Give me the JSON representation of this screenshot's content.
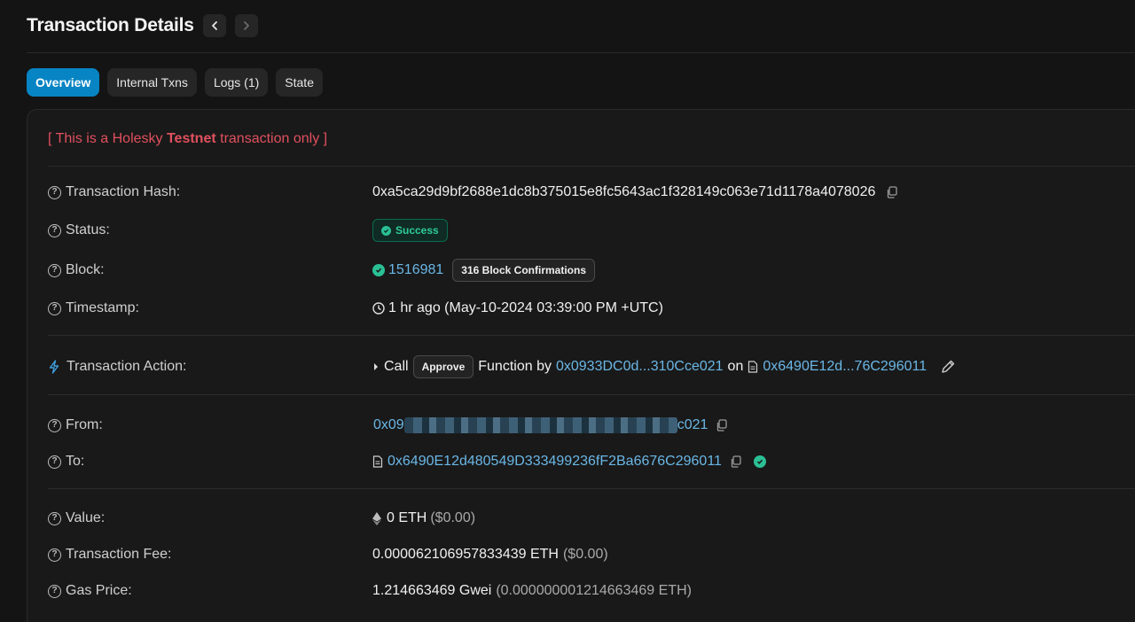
{
  "header": {
    "title": "Transaction Details",
    "prev_icon": "chevron-left-icon",
    "next_icon": "chevron-right-icon"
  },
  "tabs": [
    {
      "label": "Overview",
      "active": true
    },
    {
      "label": "Internal Txns",
      "active": false
    },
    {
      "label": "Logs (1)",
      "active": false
    },
    {
      "label": "State",
      "active": false
    }
  ],
  "notice": {
    "prefix": "[ This is a Holesky ",
    "bold": "Testnet",
    "suffix": " transaction only ]"
  },
  "rows": {
    "hash": {
      "label": "Transaction Hash:",
      "value": "0xa5ca29d9bf2688e1dc8b375015e8fc5643ac1f328149c063e71d1178a4078026"
    },
    "status": {
      "label": "Status:",
      "value": "Success"
    },
    "block": {
      "label": "Block:",
      "number": "1516981",
      "confirmations": "316 Block Confirmations"
    },
    "timestamp": {
      "label": "Timestamp:",
      "value": "1 hr ago (May-10-2024 03:39:00 PM +UTC)"
    },
    "action": {
      "label": "Transaction Action:",
      "call": "Call",
      "method": "Approve",
      "function_by": "Function by",
      "caller": "0x0933DC0d...310Cce021",
      "on": "on",
      "contract": "0x6490E12d...76C296011"
    },
    "from": {
      "label": "From:",
      "prefix": "0x09",
      "suffix": "c021"
    },
    "to": {
      "label": "To:",
      "value": "0x6490E12d480549D333499236fF2Ba6676C296011"
    },
    "value": {
      "label": "Value:",
      "amount": "0 ETH",
      "usd": "($0.00)"
    },
    "fee": {
      "label": "Transaction Fee:",
      "amount": "0.000062106957833439 ETH",
      "usd": "($0.00)"
    },
    "gas": {
      "label": "Gas Price:",
      "amount": "1.214663469 Gwei",
      "eth": "(0.000000001214663469 ETH)"
    }
  },
  "colors": {
    "accent": "#0784c3",
    "link": "#6ab7e6",
    "success": "#2bbf95",
    "warning": "#e0505e"
  }
}
